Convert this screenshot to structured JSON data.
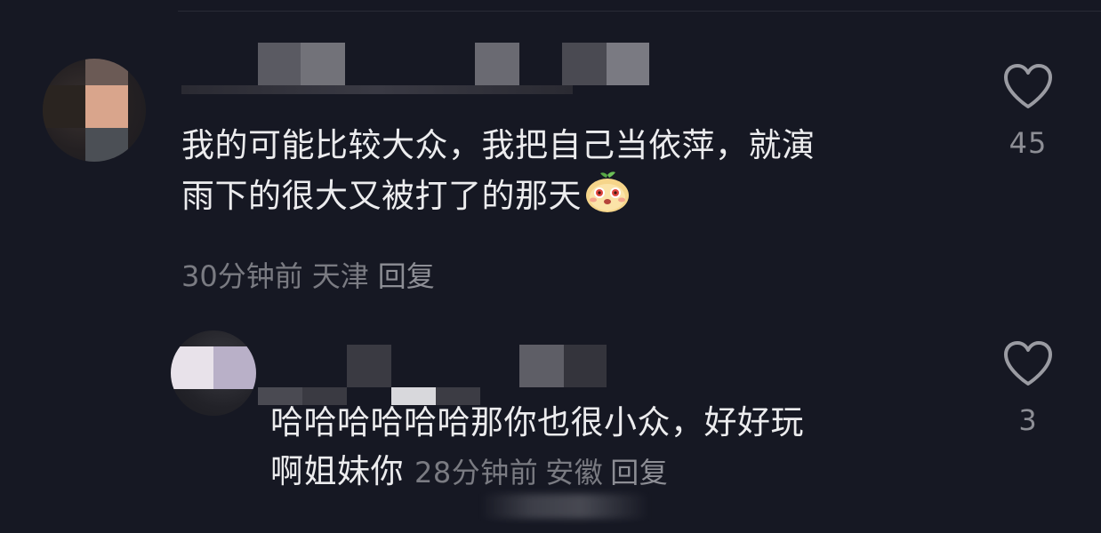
{
  "comments": [
    {
      "text_line1": "我的可能比较大众，我把自己当依萍，就演",
      "text_line2": "雨下的很大又被打了的那天",
      "emoji_icon": "smiling-face-emoji",
      "time": "30分钟前",
      "location": "天津",
      "reply_label": "回复",
      "like_count": "45"
    },
    {
      "text_line1": "哈哈哈哈哈哈那你也很小众，好好玩",
      "text_line2": "啊姐妹你",
      "time": "28分钟前",
      "location": "安徽",
      "reply_label": "回复",
      "like_count": "3"
    }
  ],
  "colors": {
    "background": "#161823",
    "text": "#ececee",
    "meta": "#7a7b82"
  }
}
